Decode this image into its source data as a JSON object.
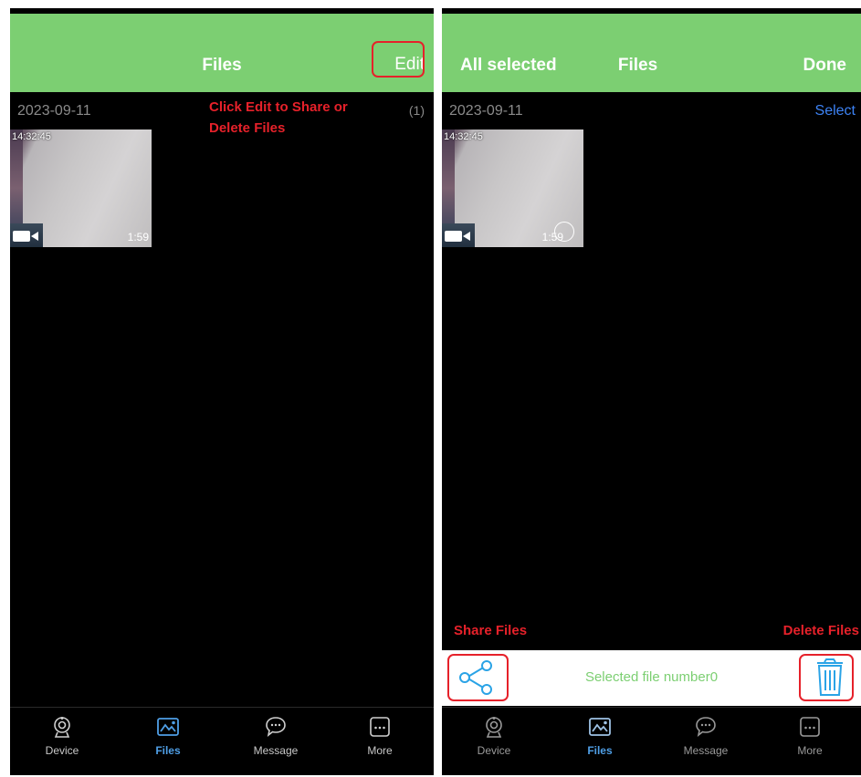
{
  "left_screen": {
    "header": {
      "title": "Files",
      "edit_label": "Edit"
    },
    "date": "2023-09-11",
    "count": "(1)",
    "thumbnail": {
      "timestamp": "14:32:45",
      "duration": "1:59"
    },
    "annotation": "Click Edit to Share or Delete Files"
  },
  "right_screen": {
    "header": {
      "title": "Files",
      "all_selected_label": "All selected",
      "done_label": "Done"
    },
    "date": "2023-09-11",
    "select_label": "Select",
    "thumbnail": {
      "timestamp": "14:32:45",
      "duration": "1:59"
    },
    "share_annotation": "Share Files",
    "delete_annotation": "Delete Files",
    "selected_text": "Selected file number0"
  },
  "tabs": [
    {
      "label": "Device",
      "icon": "camera-icon"
    },
    {
      "label": "Files",
      "icon": "image-icon"
    },
    {
      "label": "Message",
      "icon": "chat-icon"
    },
    {
      "label": "More",
      "icon": "more-icon"
    }
  ],
  "colors": {
    "header_green": "#7ccf72",
    "accent_blue": "#4f9fe6",
    "annotation_red": "#e6212a",
    "select_blue": "#3d83f5"
  }
}
